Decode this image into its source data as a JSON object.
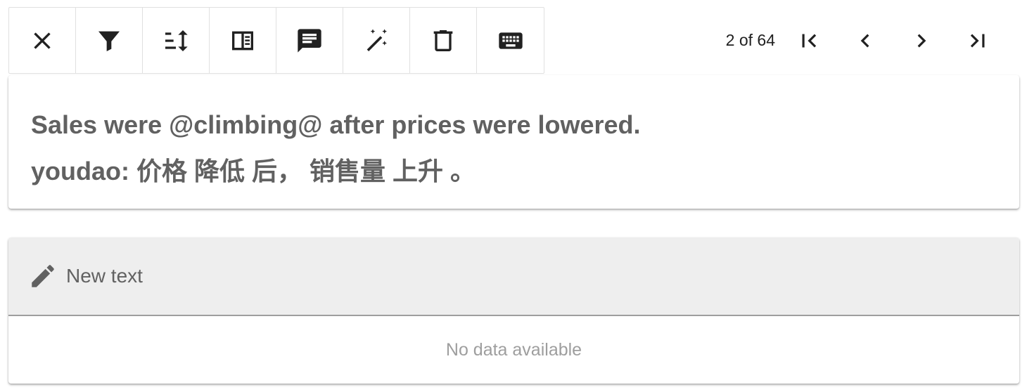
{
  "toolbar": {
    "buttons": [
      {
        "name": "close",
        "icon": "close-icon"
      },
      {
        "name": "filter",
        "icon": "filter-icon"
      },
      {
        "name": "sort",
        "icon": "sort-icon"
      },
      {
        "name": "split-view",
        "icon": "split-view-icon"
      },
      {
        "name": "comment",
        "icon": "comment-icon"
      },
      {
        "name": "magic",
        "icon": "magic-wand-icon"
      },
      {
        "name": "delete",
        "icon": "trash-icon"
      },
      {
        "name": "keyboard",
        "icon": "keyboard-icon"
      }
    ]
  },
  "pager": {
    "count_text": "2 of 64",
    "first_icon": "first-page-icon",
    "prev_icon": "chevron-left-icon",
    "next_icon": "chevron-right-icon",
    "last_icon": "last-page-icon"
  },
  "source": {
    "line1": "Sales were @climbing@ after prices were lowered.",
    "line2": "youdao: 价格 降低 后， 销售量 上升 。"
  },
  "editor": {
    "header_label": "New text",
    "header_icon": "pencil-icon",
    "empty_text": "No data available"
  }
}
